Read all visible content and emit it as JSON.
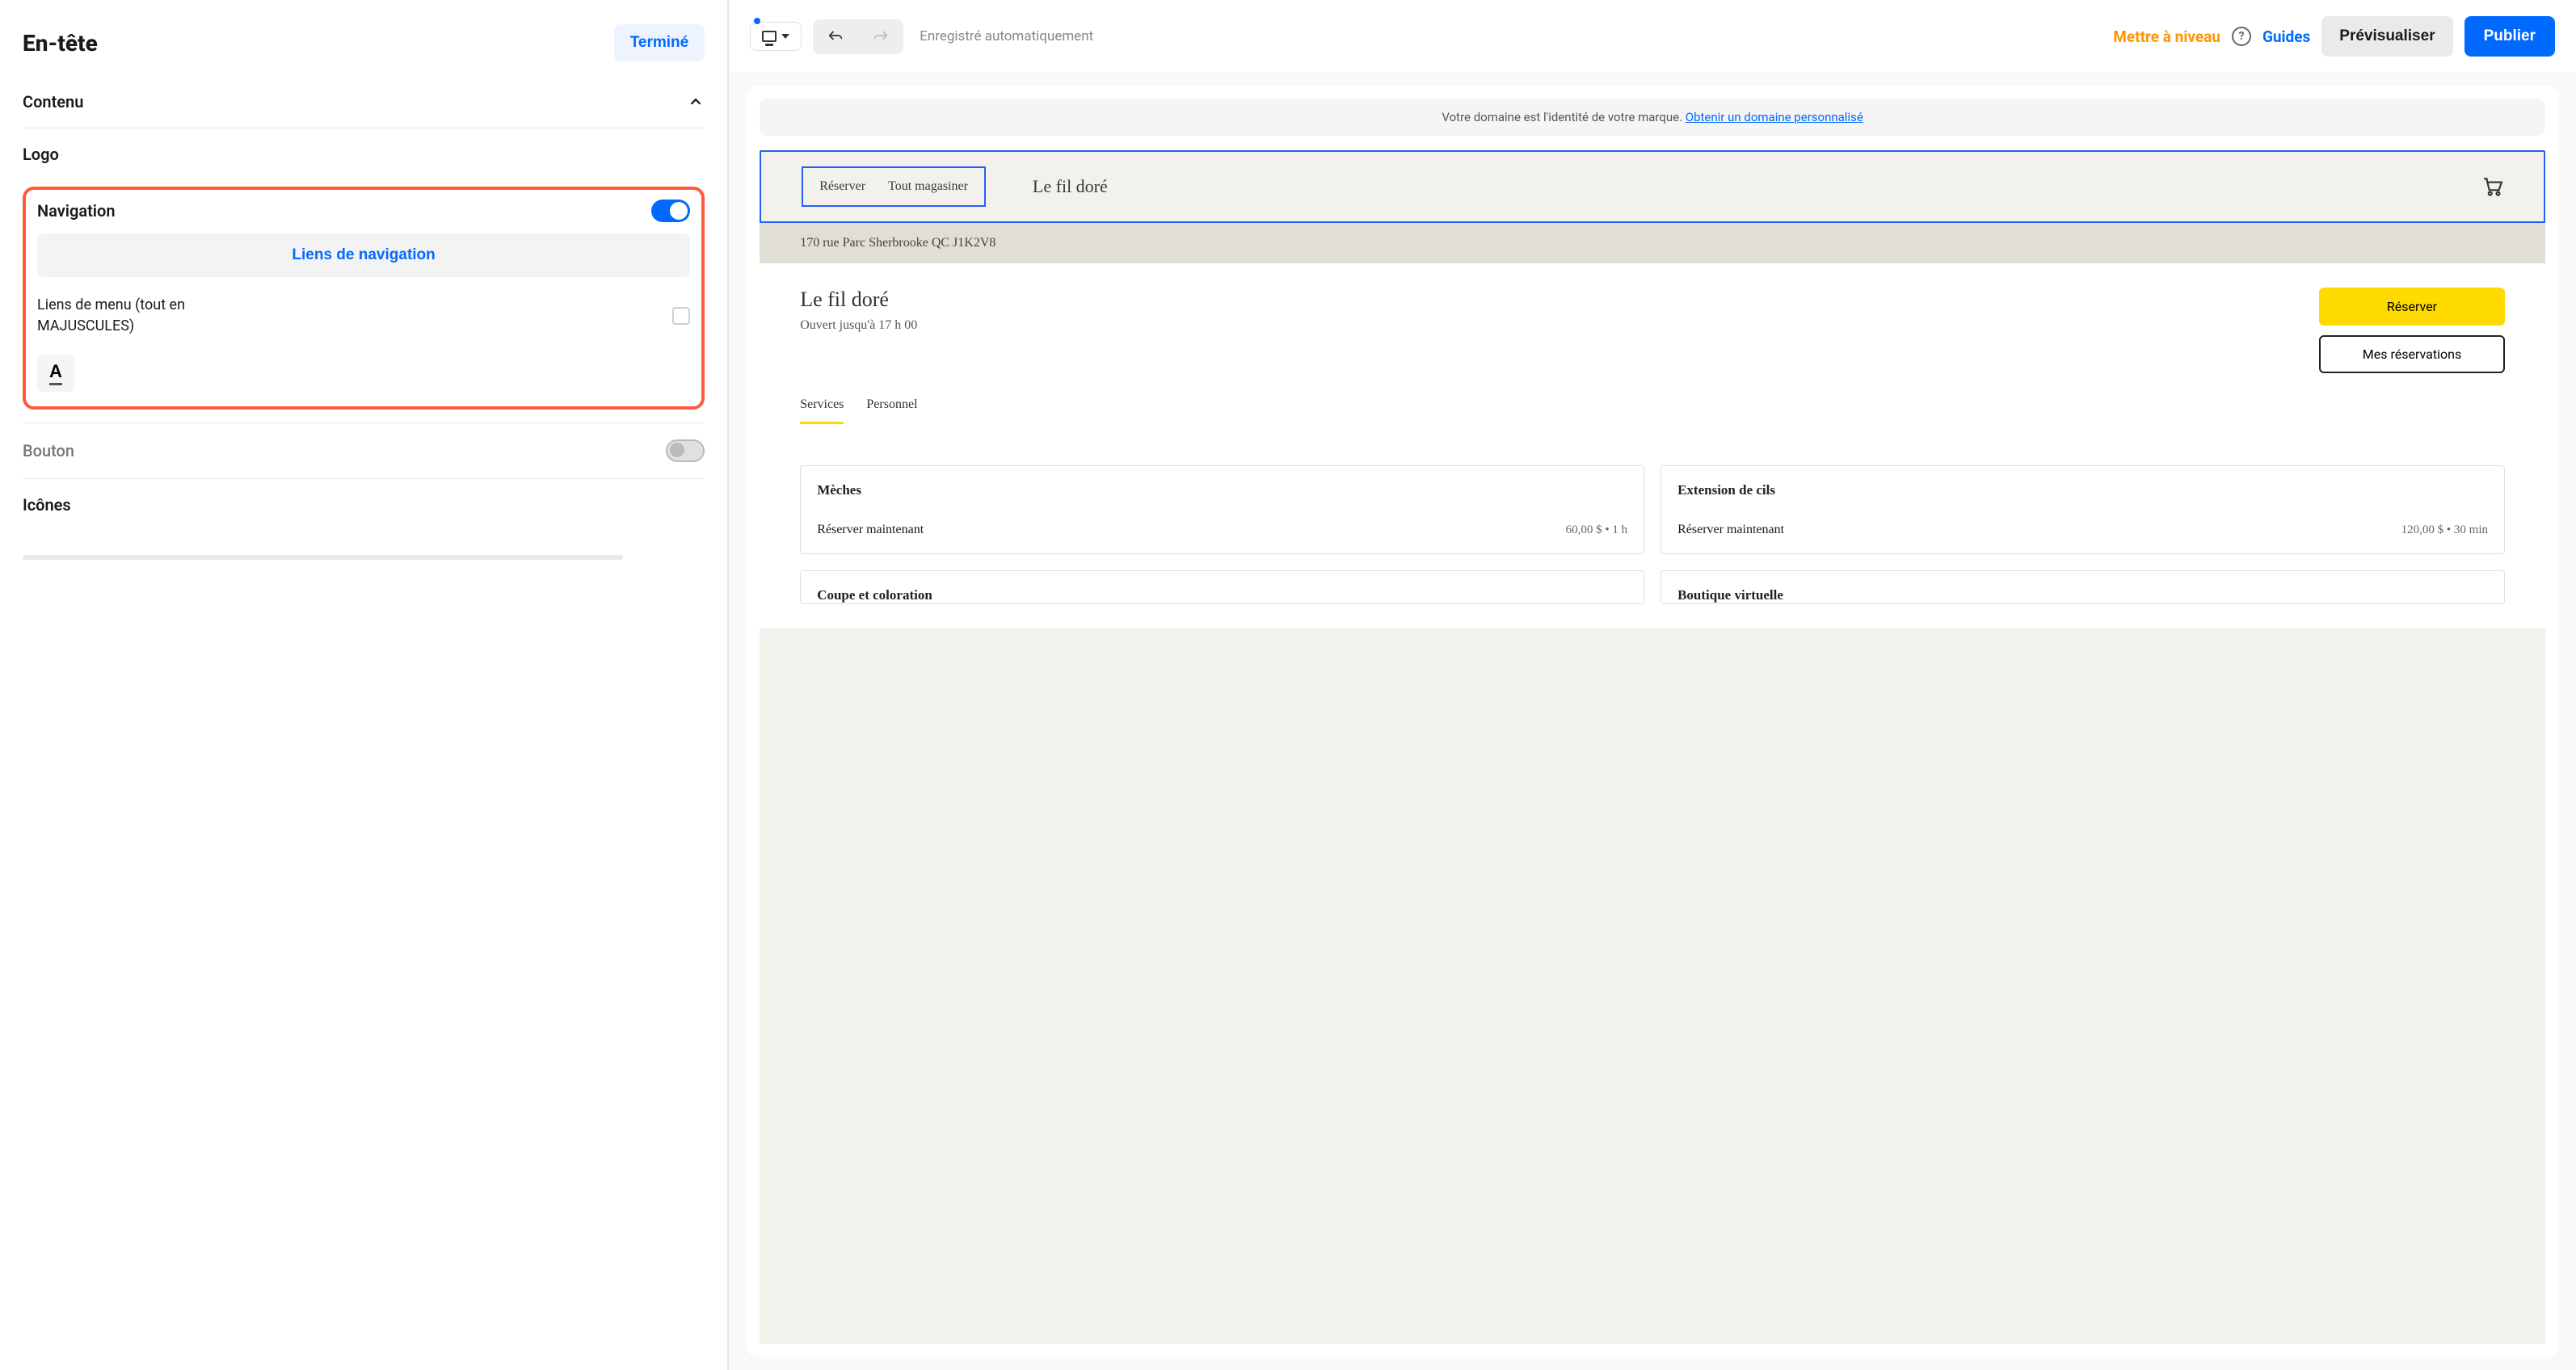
{
  "sidebar": {
    "title": "En-tête",
    "done": "Terminé",
    "content_section": "Contenu",
    "logo": "Logo",
    "navigation": {
      "title": "Navigation",
      "links_button": "Liens de navigation",
      "menu_caps_label": "Liens de menu (tout en MAJUSCULES)"
    },
    "button_section": "Bouton",
    "icons_section": "Icônes"
  },
  "topbar": {
    "save_status": "Enregistré automatiquement",
    "upgrade": "Mettre à niveau",
    "guides": "Guides",
    "preview": "Prévisualiser",
    "publish": "Publier"
  },
  "banner": {
    "text": "Votre domaine est l'identité de votre marque. ",
    "link": "Obtenir un domaine personnalisé"
  },
  "preview": {
    "nav": {
      "reserve": "Réserver",
      "shop_all": "Tout magasiner"
    },
    "brand": "Le fil doré",
    "address": "170 rue Parc Sherbrooke QC J1K2V8",
    "hero": {
      "title": "Le fil doré",
      "hours": "Ouvert jusqu'à 17 h 00",
      "reserve_btn": "Réserver",
      "my_res_btn": "Mes réservations"
    },
    "tabs": {
      "services": "Services",
      "staff": "Personnel"
    },
    "cards": [
      {
        "title": "Mèches",
        "book": "Réserver maintenant",
        "meta": "60,00 $  •  1 h"
      },
      {
        "title": "Extension de cils",
        "book": "Réserver maintenant",
        "meta": "120,00 $  •  30 min"
      },
      {
        "title": "Coupe et coloration"
      },
      {
        "title": "Boutique virtuelle"
      }
    ]
  }
}
